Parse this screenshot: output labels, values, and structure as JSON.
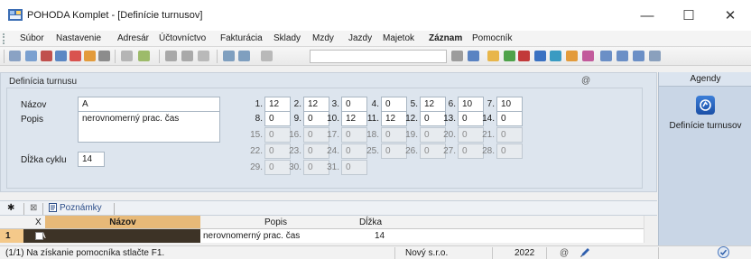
{
  "window": {
    "title": "POHODA Komplet - [Definície turnusov]",
    "minimize_glyph": "—",
    "maximize_glyph": "☐",
    "close_glyph": "✕"
  },
  "menu": [
    "Súbor",
    "Nastavenie",
    "Adresár",
    "Účtovníctvo",
    "Fakturácia",
    "Sklady",
    "Mzdy",
    "Jazdy",
    "Majetok",
    "Záznam",
    "Pomocník"
  ],
  "menu_bold_index": 9,
  "toolbar": {
    "combo_value": ""
  },
  "form": {
    "section_title": "Definícia turnusu",
    "at_symbol": "@",
    "name_label": "Názov",
    "name_value": "A",
    "desc_label": "Popis",
    "desc_value": "nerovnomerný prac. čas",
    "cycle_label": "Dĺžka cyklu",
    "cycle_value": "14"
  },
  "days": [
    {
      "num": "1.",
      "val": "12",
      "active": true
    },
    {
      "num": "2.",
      "val": "12",
      "active": true
    },
    {
      "num": "3.",
      "val": "0",
      "active": true
    },
    {
      "num": "4.",
      "val": "0",
      "active": true
    },
    {
      "num": "5.",
      "val": "12",
      "active": true
    },
    {
      "num": "6.",
      "val": "10",
      "active": true
    },
    {
      "num": "7.",
      "val": "10",
      "active": true
    },
    {
      "num": "8.",
      "val": "0",
      "active": true
    },
    {
      "num": "9.",
      "val": "0",
      "active": true
    },
    {
      "num": "10.",
      "val": "12",
      "active": true
    },
    {
      "num": "11.",
      "val": "12",
      "active": true
    },
    {
      "num": "12.",
      "val": "0",
      "active": true
    },
    {
      "num": "13.",
      "val": "0",
      "active": true
    },
    {
      "num": "14.",
      "val": "0",
      "active": true
    },
    {
      "num": "15.",
      "val": "0",
      "active": false
    },
    {
      "num": "16.",
      "val": "0",
      "active": false
    },
    {
      "num": "17.",
      "val": "0",
      "active": false
    },
    {
      "num": "18.",
      "val": "0",
      "active": false
    },
    {
      "num": "19.",
      "val": "0",
      "active": false
    },
    {
      "num": "20.",
      "val": "0",
      "active": false
    },
    {
      "num": "21.",
      "val": "0",
      "active": false
    },
    {
      "num": "22.",
      "val": "0",
      "active": false
    },
    {
      "num": "23.",
      "val": "0",
      "active": false
    },
    {
      "num": "24.",
      "val": "0",
      "active": false
    },
    {
      "num": "25.",
      "val": "0",
      "active": false
    },
    {
      "num": "26.",
      "val": "0",
      "active": false
    },
    {
      "num": "27.",
      "val": "0",
      "active": false
    },
    {
      "num": "28.",
      "val": "0",
      "active": false
    },
    {
      "num": "29.",
      "val": "0",
      "active": false
    },
    {
      "num": "30.",
      "val": "0",
      "active": false
    },
    {
      "num": "31.",
      "val": "0",
      "active": false
    }
  ],
  "tabs": {
    "star": "✱",
    "filter": "⊠",
    "notes": "Poznámky"
  },
  "table": {
    "columns": {
      "x": "X",
      "name": "Názov",
      "desc": "Popis",
      "length": "Dĺžka"
    },
    "rows": [
      {
        "index": "1",
        "name": "A",
        "desc": "nerovnomerný prac. čas",
        "length": "14"
      }
    ]
  },
  "status": {
    "help": "(1/1) Na získanie pomocníka stlačte F1.",
    "company": "Nový s.r.o.",
    "year": "2022",
    "at_symbol": "@"
  },
  "agendy": {
    "header": "Agendy",
    "item_label": "Definície turnusov"
  },
  "colors": {
    "panel_bg": "#dde5ee",
    "selected_row": "#3d3326",
    "header_highlight": "#e7b978",
    "agendy_bg": "#c9d6e6"
  }
}
